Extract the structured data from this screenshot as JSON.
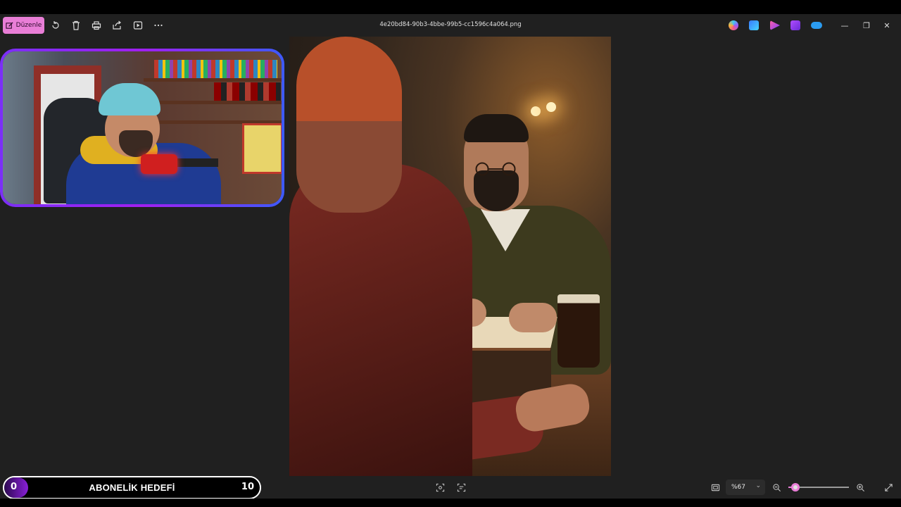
{
  "toolbar": {
    "edit_label": "Düzenle",
    "icons": [
      "rotate-icon",
      "delete-icon",
      "print-icon",
      "share-icon",
      "slideshow-icon",
      "more-icon"
    ]
  },
  "window": {
    "title": "4e20bd84-90b3-4bbe-99b5-cc1596c4a064.png",
    "app_icons": [
      "copilot-icon",
      "designer-icon",
      "clipchamp-icon",
      "video-editor-icon",
      "onedrive-icon"
    ],
    "controls": {
      "minimize": "—",
      "restore": "❐",
      "close": "✕"
    },
    "accent": "#e97ed7"
  },
  "bottombar": {
    "zoom_value": "%67",
    "zoom_level": 0.12,
    "icons": [
      "favorite-icon",
      "info-icon",
      "file-icon",
      "crop-fit-icon",
      "text-scan-icon",
      "fit-window-icon",
      "zoom-out-icon",
      "zoom-in-icon",
      "fullscreen-icon"
    ]
  },
  "goal_widget": {
    "start": "0",
    "label": "ABONELİK HEDEFİ",
    "target": "10",
    "gradient_from": "#2d0a52",
    "gradient_to": "#8a1fd8"
  },
  "webcam": {
    "border_from": "#7b2ff7",
    "border_to": "#3d5afe"
  }
}
